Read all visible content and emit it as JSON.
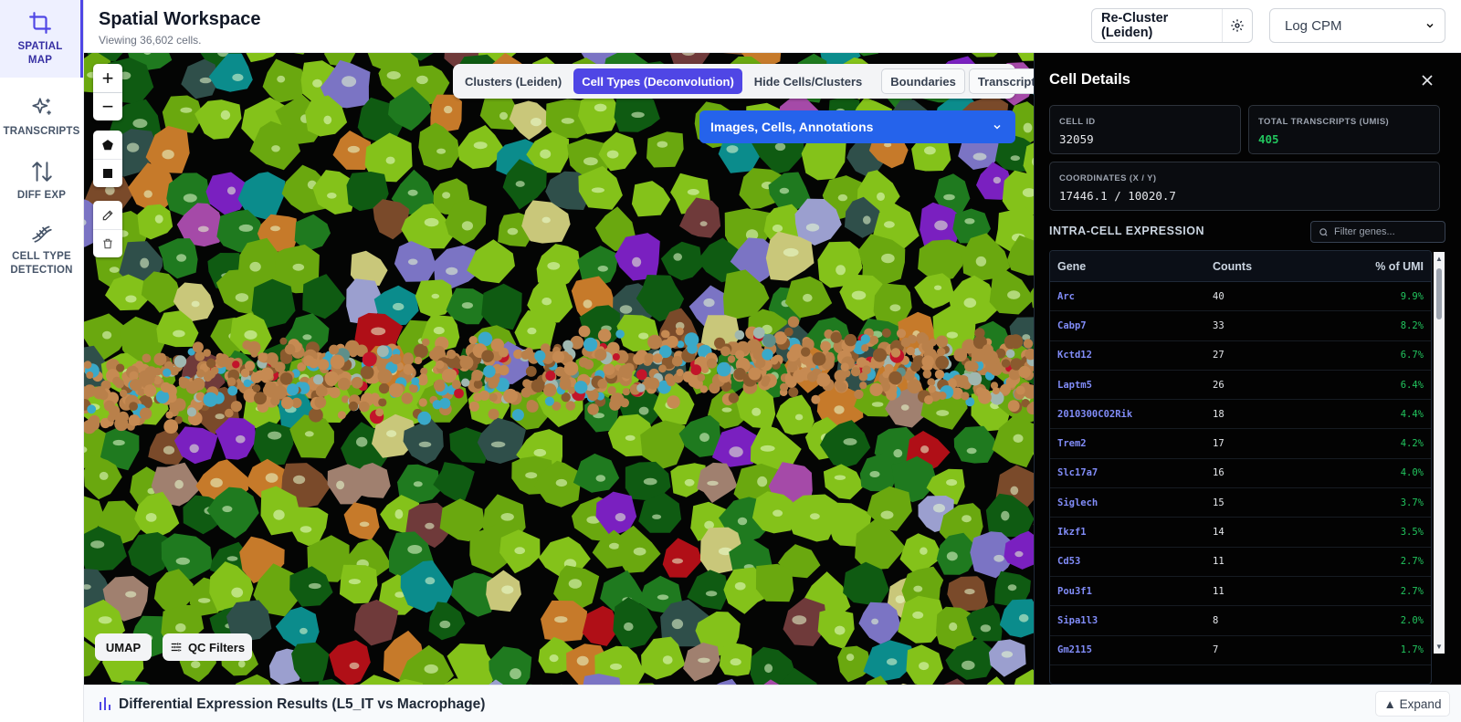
{
  "nav": {
    "items": [
      {
        "label_1": "SPATIAL",
        "label_2": "MAP",
        "icon": "crop-icon"
      },
      {
        "label_1": "TRANSCRIPTS",
        "label_2": "",
        "icon": "sparkles-icon"
      },
      {
        "label_1": "DIFF EXP",
        "label_2": "",
        "icon": "arrow-up-down-icon"
      },
      {
        "label_1": "CELL TYPE",
        "label_2": "DETECTION",
        "icon": "dna-icon"
      }
    ],
    "active_index": 0
  },
  "header": {
    "title": "Spatial Workspace",
    "subtitle": "Viewing 36,602 cells.",
    "recluster_label": "Re-Cluster (Leiden)",
    "normalization": "Log CPM"
  },
  "map": {
    "toggles": {
      "clusters": "Clusters (Leiden)",
      "cell_types": "Cell Types (Deconvolution)",
      "hide": "Hide Cells/Clusters",
      "boundaries": "Boundaries",
      "transcripts": "Transcripts"
    },
    "active_toggle": "cell_types",
    "layers_label": "Images, Cells, Annotations",
    "umap_label": "UMAP",
    "qc_label": "QC Filters",
    "zoom_in": "+",
    "zoom_out": "−"
  },
  "panel": {
    "title": "Cell Details",
    "cell_id_label": "CELL ID",
    "cell_id": "32059",
    "umis_label": "TOTAL TRANSCRIPTS (UMIS)",
    "umis": "405",
    "coords_label": "COORDINATES (X / Y)",
    "coords": "17446.1 / 10020.7",
    "section_title": "INTRA-CELL EXPRESSION",
    "filter_placeholder": "Filter genes...",
    "columns": [
      "Gene",
      "Counts",
      "% of UMI"
    ],
    "rows": [
      {
        "gene": "Arc",
        "counts": "40",
        "pct": "9.9%"
      },
      {
        "gene": "Cabp7",
        "counts": "33",
        "pct": "8.2%"
      },
      {
        "gene": "Kctd12",
        "counts": "27",
        "pct": "6.7%"
      },
      {
        "gene": "Laptm5",
        "counts": "26",
        "pct": "6.4%"
      },
      {
        "gene": "2010300C02Rik",
        "counts": "18",
        "pct": "4.4%"
      },
      {
        "gene": "Trem2",
        "counts": "17",
        "pct": "4.2%"
      },
      {
        "gene": "Slc17a7",
        "counts": "16",
        "pct": "4.0%"
      },
      {
        "gene": "Siglech",
        "counts": "15",
        "pct": "3.7%"
      },
      {
        "gene": "Ikzf1",
        "counts": "14",
        "pct": "3.5%"
      },
      {
        "gene": "Cd53",
        "counts": "11",
        "pct": "2.7%"
      },
      {
        "gene": "Pou3f1",
        "counts": "11",
        "pct": "2.7%"
      },
      {
        "gene": "Sipa1l3",
        "counts": "8",
        "pct": "2.0%"
      },
      {
        "gene": "Gm2115",
        "counts": "7",
        "pct": "1.7%"
      }
    ]
  },
  "bottom": {
    "title": "Differential Expression Results (L5_IT vs Macrophage)",
    "expand_label": "▲ Expand"
  },
  "colors": {
    "accent": "#4f46e5",
    "layer_button": "#2563eb",
    "umi_green": "#22c55e",
    "gene_link": "#818cf8",
    "cell_palette": [
      "#6aa80f",
      "#84c21a",
      "#0f5b12",
      "#1f7a1f",
      "#c67a2a",
      "#7b74c4",
      "#9b9fcf",
      "#2f4f4a",
      "#0b8c8c",
      "#b00f17",
      "#a54aa8",
      "#7a4a2a",
      "#c9c77a",
      "#6f3a3a",
      "#a0806f",
      "#7a20c0"
    ]
  }
}
